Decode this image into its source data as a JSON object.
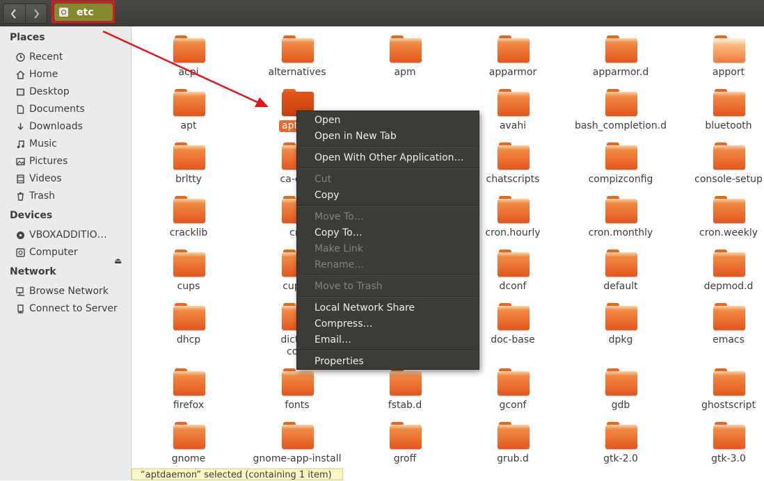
{
  "header": {
    "path_label": "etc",
    "back_icon": "chevron-left-icon",
    "forward_icon": "chevron-right-icon",
    "path_icon": "drive-icon"
  },
  "sidebar": {
    "places_title": "Places",
    "places": [
      {
        "label": "Recent",
        "icon": "clock-icon"
      },
      {
        "label": "Home",
        "icon": "home-icon"
      },
      {
        "label": "Desktop",
        "icon": "desktop-icon"
      },
      {
        "label": "Documents",
        "icon": "document-icon"
      },
      {
        "label": "Downloads",
        "icon": "download-icon"
      },
      {
        "label": "Music",
        "icon": "music-icon"
      },
      {
        "label": "Pictures",
        "icon": "picture-icon"
      },
      {
        "label": "Videos",
        "icon": "video-icon"
      },
      {
        "label": "Trash",
        "icon": "trash-icon"
      }
    ],
    "devices_title": "Devices",
    "devices": [
      {
        "label": "VBOXADDITIO…",
        "icon": "disc-icon"
      },
      {
        "label": "Computer",
        "icon": "computer-icon"
      }
    ],
    "network_title": "Network",
    "network": [
      {
        "label": "Browse Network",
        "icon": "network-icon"
      },
      {
        "label": "Connect to Server",
        "icon": "server-icon"
      }
    ]
  },
  "files": [
    [
      "acpi",
      "alternatives",
      "apm",
      "apparmor",
      "apparmor.d",
      "apport"
    ],
    [
      "apt",
      "aptdaemon",
      "",
      "avahi",
      "bash_completion.d",
      "bluetooth"
    ],
    [
      "brltty",
      "ca-certificates",
      "",
      "chatscripts",
      "compizconfig",
      "console-setup"
    ],
    [
      "cracklib",
      "cron.d",
      "",
      "cron.hourly",
      "cron.monthly",
      "cron.weekly"
    ],
    [
      "cups",
      "cupshelpers",
      "",
      "dconf",
      "default",
      "depmod.d"
    ],
    [
      "dhcp",
      "dictionaries-common",
      "",
      "doc-base",
      "dpkg",
      "emacs"
    ],
    [
      "firefox",
      "fonts",
      "fstab.d",
      "gconf",
      "gdb",
      "ghostscript"
    ],
    [
      "gnome",
      "gnome-app-install",
      "groff",
      "grub.d",
      "gtk-2.0",
      "gtk-3.0"
    ]
  ],
  "visible_names": {
    "r2c1": "aptda",
    "r3c1": "ca-cert",
    "r4c1": "cro",
    "r5c1": "cupsh",
    "r6c1a": "diction",
    "r6c1b": "com"
  },
  "context_menu": {
    "open": "Open",
    "open_new_tab": "Open in New Tab",
    "open_with": "Open With Other Application…",
    "cut": "Cut",
    "copy": "Copy",
    "move_to": "Move To…",
    "copy_to": "Copy To…",
    "make_link": "Make Link",
    "rename": "Rename…",
    "move_to_trash": "Move to Trash",
    "local_network_share": "Local Network Share",
    "compress": "Compress…",
    "email": "Email…",
    "properties": "Properties"
  },
  "status": {
    "text": "“aptdaemon” selected  (containing 1 item)"
  },
  "colors": {
    "accent": "#e86b2c",
    "highlight_box": "#e0161b",
    "path_button": "#858b2c",
    "menu_bg": "#3c3b37"
  }
}
